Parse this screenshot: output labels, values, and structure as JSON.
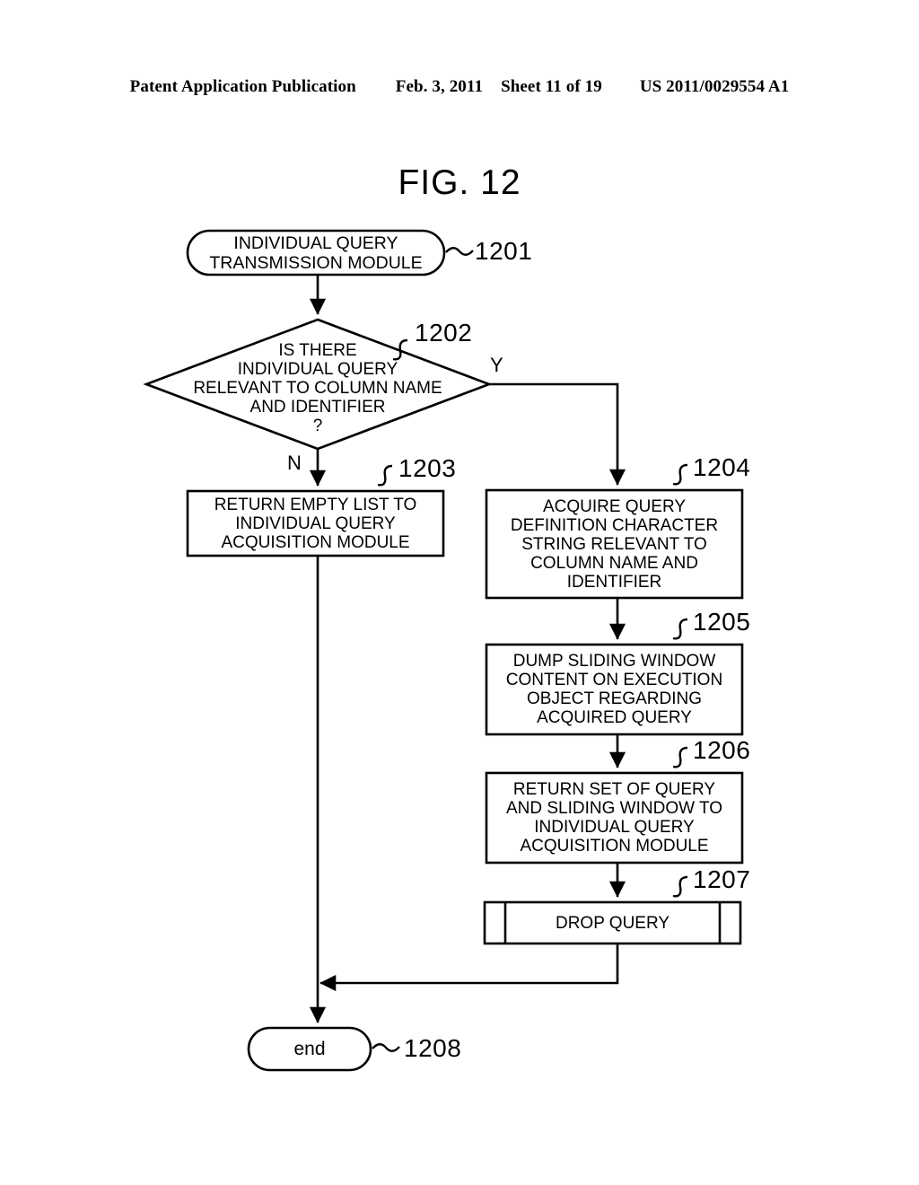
{
  "header": {
    "publication": "Patent Application Publication",
    "date": "Feb. 3, 2011",
    "sheet": "Sheet 11 of 19",
    "patent_number": "US 2011/0029554 A1"
  },
  "figure": {
    "title": "FIG. 12"
  },
  "nodes": {
    "start": {
      "ref": "1201",
      "shape": "terminator",
      "lines": [
        "INDIVIDUAL QUERY",
        "TRANSMISSION MODULE"
      ]
    },
    "decision": {
      "ref": "1202",
      "shape": "diamond",
      "lines": [
        "IS THERE",
        "INDIVIDUAL QUERY",
        "RELEVANT TO COLUMN NAME",
        "AND IDENTIFIER",
        "?"
      ],
      "yes_label": "Y",
      "no_label": "N"
    },
    "step_1203": {
      "ref": "1203",
      "shape": "process",
      "lines": [
        "RETURN EMPTY LIST TO",
        "INDIVIDUAL QUERY",
        "ACQUISITION MODULE"
      ]
    },
    "step_1204": {
      "ref": "1204",
      "shape": "process",
      "lines": [
        "ACQUIRE QUERY",
        "DEFINITION CHARACTER",
        "STRING RELEVANT TO",
        "COLUMN NAME AND",
        "IDENTIFIER"
      ]
    },
    "step_1205": {
      "ref": "1205",
      "shape": "process",
      "lines": [
        "DUMP SLIDING WINDOW",
        "CONTENT ON EXECUTION",
        "OBJECT REGARDING",
        "ACQUIRED QUERY"
      ]
    },
    "step_1206": {
      "ref": "1206",
      "shape": "process",
      "lines": [
        "RETURN SET OF QUERY",
        "AND SLIDING WINDOW TO",
        "INDIVIDUAL QUERY",
        "ACQUISITION MODULE"
      ]
    },
    "step_1207": {
      "ref": "1207",
      "shape": "predefined-process",
      "lines": [
        "DROP QUERY"
      ]
    },
    "end": {
      "ref": "1208",
      "shape": "terminator",
      "lines": [
        "end"
      ]
    }
  },
  "colors": {
    "ink": "#000000",
    "paper": "#ffffff"
  }
}
